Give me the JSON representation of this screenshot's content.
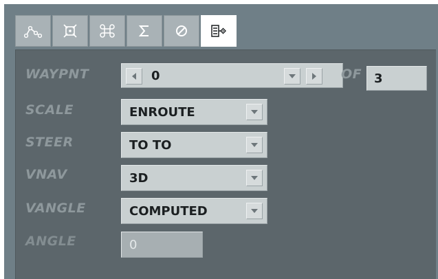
{
  "tabs": [
    {
      "icon": "path-curve-icon",
      "active": false
    },
    {
      "icon": "waypoint-target-icon",
      "active": false
    },
    {
      "icon": "command-key-icon",
      "active": false
    },
    {
      "icon": "sigma-icon",
      "active": false
    },
    {
      "icon": "cancel-circle-icon",
      "active": false
    },
    {
      "icon": "list-waypoint-icon",
      "active": true
    }
  ],
  "waypnt": {
    "label": "WAYPNT",
    "value": "0",
    "of_label": "OF",
    "total": "3"
  },
  "scale": {
    "label": "SCALE",
    "value": "ENROUTE"
  },
  "steer": {
    "label": "STEER",
    "value": "TO TO"
  },
  "vnav": {
    "label": "VNAV",
    "value": "3D"
  },
  "vangle": {
    "label": "VANGLE",
    "value": "COMPUTED"
  },
  "angle": {
    "label": "ANGLE",
    "value": "0"
  },
  "colors": {
    "window_bg": "#6f7f87",
    "panel_bg": "#5c666b",
    "label": "#8e989c",
    "field_bg": "#c9d0d1",
    "active_tab": "#ffffff"
  }
}
